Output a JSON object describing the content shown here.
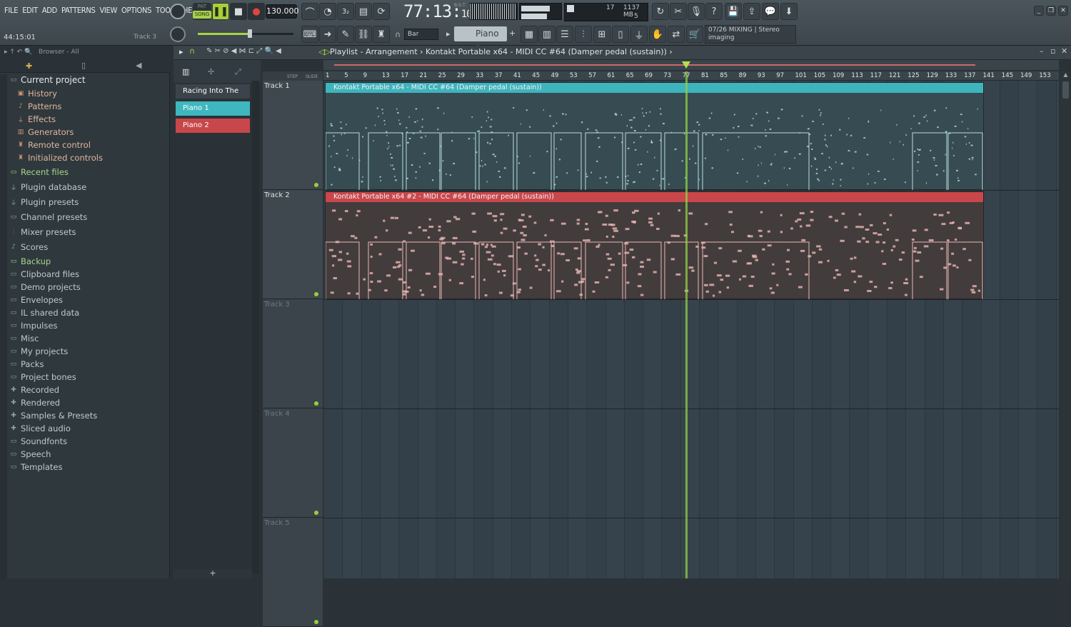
{
  "menu": [
    "FILE",
    "EDIT",
    "ADD",
    "PATTERNS",
    "VIEW",
    "OPTIONS",
    "TOOLS",
    "HELP"
  ],
  "hint_time": "44:15:01",
  "hint_target": "Track 3",
  "transport": {
    "pat_label": "PAT",
    "song_label": "SONG",
    "bpm": "130.000"
  },
  "time": {
    "main": "77:13",
    "sub": "10",
    "unit": "B:S:T"
  },
  "monitor": {
    "voices": "17",
    "memory": "1137 MB",
    "cpu": "5"
  },
  "snap": "Bar",
  "pattern_selector": "Piano 2",
  "hint_panel": {
    "line1": "07/26  MIXING | Stereo",
    "line2": "imaging"
  },
  "browser": {
    "title": "Browser - All",
    "items": [
      {
        "label": "Current project",
        "level": "top",
        "icon": "folder-icon"
      },
      {
        "label": "History",
        "level": "sub",
        "icon": "history-icon"
      },
      {
        "label": "Patterns",
        "level": "sub",
        "icon": "note-icon"
      },
      {
        "label": "Effects",
        "level": "sub",
        "icon": "plug-icon"
      },
      {
        "label": "Generators",
        "level": "sub",
        "icon": "keyboard-icon"
      },
      {
        "label": "Remote control",
        "level": "sub",
        "icon": "hand-icon"
      },
      {
        "label": "Initialized controls",
        "level": "sub",
        "icon": "hand-icon"
      },
      {
        "label": "Recent files",
        "level": "green",
        "icon": "folder-icon"
      },
      {
        "label": "Plugin database",
        "level": "root",
        "icon": "plug-icon"
      },
      {
        "label": "Plugin presets",
        "level": "root",
        "icon": "plug-icon"
      },
      {
        "label": "Channel presets",
        "level": "root",
        "icon": "folder-icon"
      },
      {
        "label": "Mixer presets",
        "level": "root",
        "icon": "mixer-icon"
      },
      {
        "label": "Scores",
        "level": "root",
        "icon": "note-icon"
      },
      {
        "label": "Backup",
        "level": "green",
        "icon": "folder-icon"
      },
      {
        "label": "Clipboard files",
        "level": "root",
        "icon": "folder-icon"
      },
      {
        "label": "Demo projects",
        "level": "root",
        "icon": "folder-icon"
      },
      {
        "label": "Envelopes",
        "level": "root",
        "icon": "folder-icon"
      },
      {
        "label": "IL shared data",
        "level": "root",
        "icon": "folder-icon"
      },
      {
        "label": "Impulses",
        "level": "root",
        "icon": "folder-icon"
      },
      {
        "label": "Misc",
        "level": "root",
        "icon": "folder-icon"
      },
      {
        "label": "My projects",
        "level": "root",
        "icon": "folder-icon"
      },
      {
        "label": "Packs",
        "level": "root",
        "icon": "folder-icon"
      },
      {
        "label": "Project bones",
        "level": "root",
        "icon": "folder-icon"
      },
      {
        "label": "Recorded",
        "level": "root",
        "icon": "plus-icon"
      },
      {
        "label": "Rendered",
        "level": "root",
        "icon": "plus-icon"
      },
      {
        "label": "Samples & Presets",
        "level": "root",
        "icon": "plus-icon"
      },
      {
        "label": "Sliced audio",
        "level": "root",
        "icon": "plus-icon"
      },
      {
        "label": "Soundfonts",
        "level": "root",
        "icon": "folder-icon"
      },
      {
        "label": "Speech",
        "level": "root",
        "icon": "folder-icon"
      },
      {
        "label": "Templates",
        "level": "root",
        "icon": "folder-icon"
      }
    ]
  },
  "playlist": {
    "breadcrumb": "Playlist - Arrangement  ›  Kontakt Portable x64 - MIDI CC #64 (Damper pedal (sustain))  ›",
    "step_label": "STEP",
    "slide_label": "SLIDE"
  },
  "channels": [
    {
      "label": "Racing Into The Night",
      "color": "#3a444a"
    },
    {
      "label": "Piano 1",
      "color": "#3fb7bf"
    },
    {
      "label": "Piano 2",
      "color": "#c8474a"
    }
  ],
  "tracks": [
    {
      "label": "Track 1",
      "dim": false
    },
    {
      "label": "Track 2",
      "dim": false
    },
    {
      "label": "Track 3",
      "dim": true
    },
    {
      "label": "Track 4",
      "dim": true
    },
    {
      "label": "Track 5",
      "dim": true
    }
  ],
  "ruler_ticks": [
    "1",
    "5",
    "9",
    "13",
    "17",
    "21",
    "25",
    "29",
    "33",
    "37",
    "41",
    "45",
    "49",
    "53",
    "57",
    "61",
    "65",
    "69",
    "73",
    "77",
    "81",
    "85",
    "89",
    "93",
    "97",
    "101",
    "105",
    "109",
    "113",
    "117",
    "121",
    "125",
    "129",
    "133",
    "137",
    "141",
    "145",
    "149",
    "153"
  ],
  "clips": [
    {
      "title": "Kontakt Portable x64 - MIDI CC #64 (Damper pedal (sustain))",
      "color": "#3fb4bd",
      "note": "#b9dde0"
    },
    {
      "title": "Kontakt Portable x64 #2 - MIDI CC #64 (Damper pedal (sustain))",
      "color": "#c9474b",
      "note": "#eab8b4"
    }
  ]
}
